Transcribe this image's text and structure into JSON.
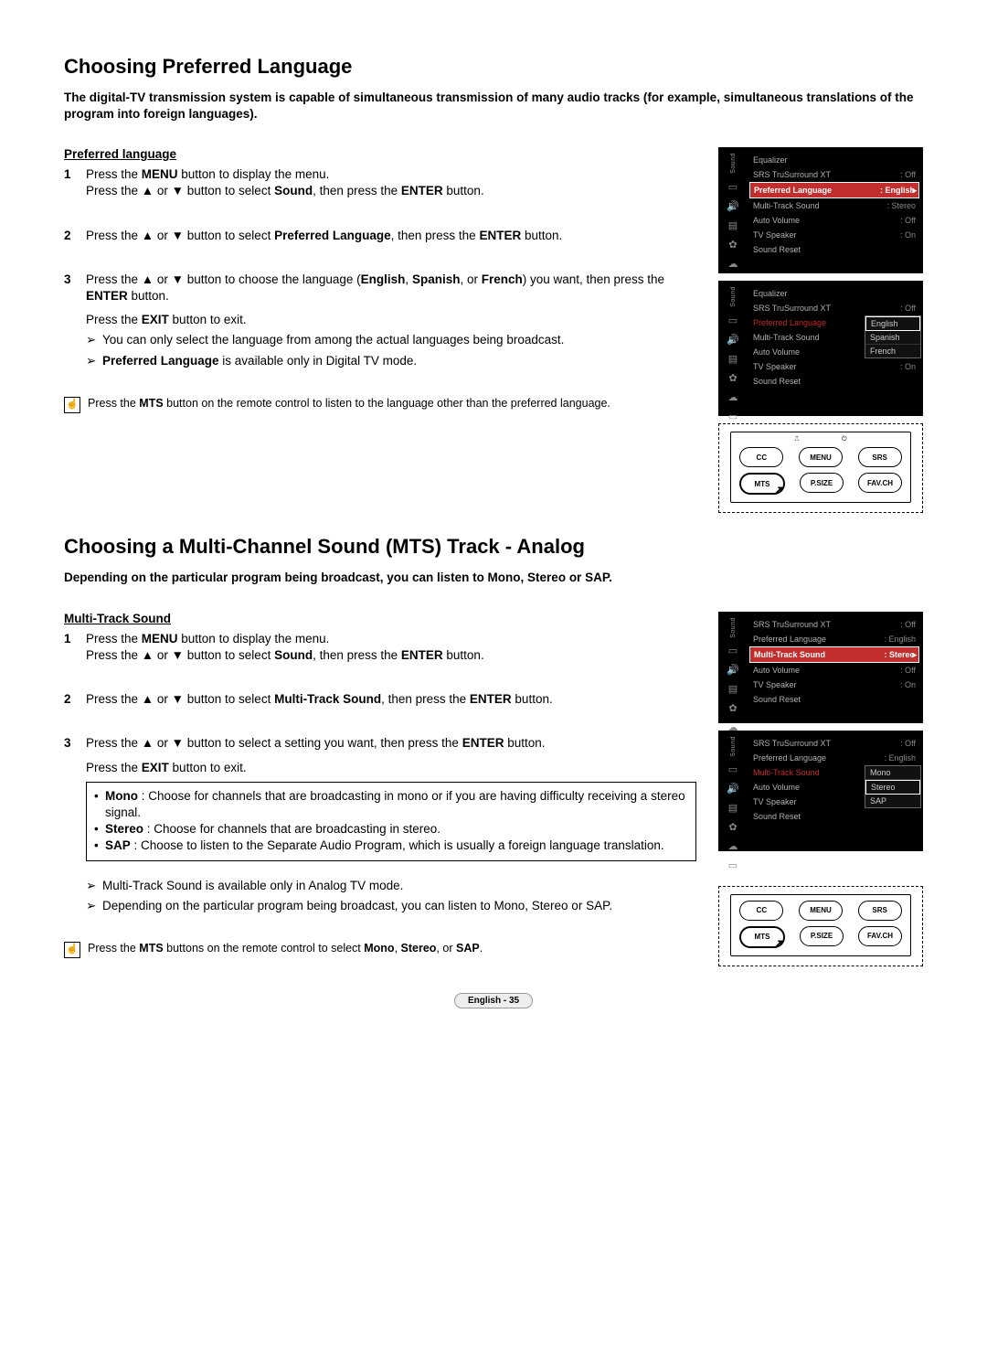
{
  "footer": "English - 35",
  "sec1": {
    "title": "Choosing Preferred Language",
    "intro": "The digital-TV transmission system is capable of simultaneous transmission of many audio tracks (for example, simultaneous translations of the program into foreign languages).",
    "subhead": "Preferred language",
    "steps": {
      "s1a": "Press the ",
      "s1b": " button to display the menu.",
      "s1c": "Press the ▲ or ▼ button to select ",
      "s1d": ", then press the ",
      "s1e": " button.",
      "menu": "MENU",
      "sound": "Sound",
      "enter": "ENTER",
      "s2a": "Press the ▲ or ▼ button to select ",
      "s2b": ", then press the ",
      "s2c": " button.",
      "preflang": "Preferred Language",
      "s3a": "Press the ▲ or ▼ button to choose the language (",
      "s3b": ") you want, then press the ",
      "s3c": " button.",
      "eng": "English",
      "spa": "Spanish",
      "fre": "French",
      "sep_or1": ", ",
      "sep_or2": ", or ",
      "exit_line_a": "Press the ",
      "exit": "EXIT",
      "exit_line_b": " button to exit.",
      "arrow1": "You can only select the language from among the actual languages being broadcast.",
      "arrow2a": "Preferred Language",
      "arrow2b": " is available only in Digital TV mode."
    },
    "note_a": "Press the ",
    "note_mts": "MTS",
    "note_b": " button on the remote control to listen to the language other than the preferred language."
  },
  "osd1": {
    "side": "Sound",
    "rows": {
      "equalizer": "Equalizer",
      "srs": "SRS TruSurround XT",
      "srs_v": ": Off",
      "pref": "Preferred Language",
      "pref_v": ": English",
      "mts": "Multi-Track Sound",
      "mts_v": ": Stereo",
      "auto": "Auto Volume",
      "auto_v": ": Off",
      "tvsp": "TV Speaker",
      "tvsp_v": ": On",
      "reset": "Sound Reset"
    }
  },
  "osd2_dd": {
    "opt1": "English",
    "opt2": "Spanish",
    "opt3": "French"
  },
  "remote": {
    "cc": "CC",
    "menu": "MENU",
    "srs": "SRS",
    "mts": "MTS",
    "psize": "P.SIZE",
    "favch": "FAV.CH"
  },
  "sec2": {
    "title": "Choosing a Multi-Channel Sound (MTS) Track - Analog",
    "intro": "Depending on the particular program being broadcast, you can listen to Mono, Stereo or SAP.",
    "subhead": "Multi-Track Sound",
    "steps": {
      "s1a": "Press the ",
      "s1b": " button to display the menu.",
      "s1c": "Press the ▲ or ▼ button to select ",
      "s1d": ", then press the ",
      "s1e": " button.",
      "menu": "MENU",
      "sound": "Sound",
      "enter": "ENTER",
      "s2a": "Press the ▲ or ▼ button to select ",
      "s2b": ", then press the ",
      "s2c": " button.",
      "mts": "Multi-Track Sound",
      "s3a": "Press the ▲ or ▼ button to select a setting you want, then press the ",
      "s3b": " button.",
      "exit_line_a": "Press the ",
      "exit": "EXIT",
      "exit_line_b": " button to exit.",
      "b_mono_l": "Mono",
      "b_mono": " : Choose for channels that are broadcasting in mono or if you are having difficulty receiving a stereo signal.",
      "b_stereo_l": "Stereo",
      "b_stereo": " : Choose for channels that are broadcasting in stereo.",
      "b_sap_l": "SAP",
      "b_sap": " : Choose to listen to the Separate Audio Program, which is usually a foreign language translation.",
      "arrow1": "Multi-Track Sound is available only in Analog TV mode.",
      "arrow2": "Depending on the particular program being broadcast, you can listen to Mono, Stereo or SAP."
    },
    "note_a": "Press the ",
    "note_mts": "MTS",
    "note_b": " buttons on the remote control to select ",
    "note_mono": "Mono",
    "note_sep1": ", ",
    "note_stereo": "Stereo",
    "note_sep2": ", or ",
    "note_sap": "SAP",
    "note_end": "."
  },
  "osd3": {
    "side": "Sound",
    "rows": {
      "srs": "SRS TruSurround XT",
      "srs_v": ": Off",
      "pref": "Preferred Language",
      "pref_v": ": English",
      "mts": "Multi-Track Sound",
      "mts_v": ": Stereo",
      "auto": "Auto Volume",
      "auto_v": ": Off",
      "tvsp": "TV Speaker",
      "tvsp_v": ": On",
      "reset": "Sound Reset"
    }
  },
  "osd4_dd": {
    "opt1": "Mono",
    "opt2": "Stereo",
    "opt3": "SAP"
  }
}
